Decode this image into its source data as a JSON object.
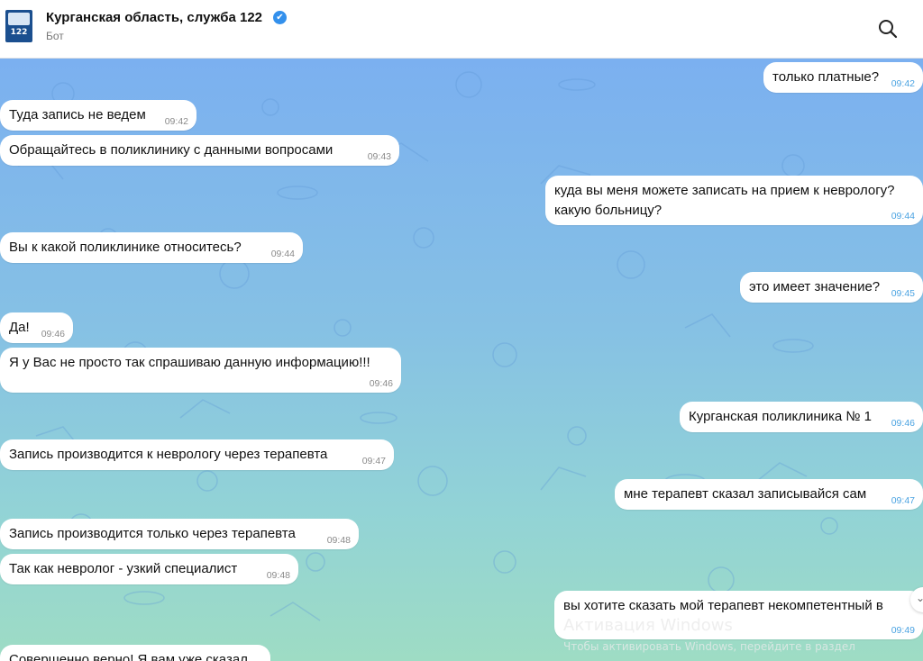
{
  "header": {
    "title": "Курганская область, служба 122",
    "subtitle": "Бот",
    "avatar_text": "122",
    "verified_glyph": "✔",
    "search_icon": "search-icon"
  },
  "messages": [
    {
      "text": "только платные?",
      "time": "09:42",
      "dir": "out"
    },
    {
      "text": "Туда запись не ведем",
      "time": "09:42",
      "dir": "in"
    },
    {
      "text": "Обращайтесь в поликлинику с данными вопросами",
      "time": "09:43",
      "dir": "in"
    },
    {
      "text": "куда вы меня можете записать на прием к неврологу?",
      "text2": "какую больницу?",
      "time": "09:44",
      "dir": "out"
    },
    {
      "text": "Вы к какой поликлинике относитесь?",
      "time": "09:44",
      "dir": "in"
    },
    {
      "text": "это имеет значение?",
      "time": "09:45",
      "dir": "out"
    },
    {
      "text": "Да!",
      "time": "09:46",
      "dir": "in"
    },
    {
      "text": "Я у Вас не просто так спрашиваю данную информацию!!!",
      "time": "09:46",
      "dir": "in"
    },
    {
      "text": "Курганская поликлиника № 1",
      "time": "09:46",
      "dir": "out"
    },
    {
      "text": "Запись производится к неврологу через терапевта",
      "time": "09:47",
      "dir": "in"
    },
    {
      "text": "мне терапевт сказал записывайся сам",
      "time": "09:47",
      "dir": "out"
    },
    {
      "text": "Запись производится только через терапевта",
      "time": "09:48",
      "dir": "in"
    },
    {
      "text": "Так как невролог - узкий специалист",
      "time": "09:48",
      "dir": "in"
    },
    {
      "text": "вы хотите сказать мой терапевт некомпетентный в",
      "time": "09:49",
      "dir": "out"
    },
    {
      "text": "Совершенно верно! Я вам уже сказал",
      "time": "",
      "dir": "in"
    }
  ],
  "watermark": {
    "title": "Активация Windows",
    "subtitle": "Чтобы активировать Windows, перейдите в раздел"
  },
  "colors": {
    "accent": "#3390ec",
    "time_out": "#4ba3e2"
  }
}
